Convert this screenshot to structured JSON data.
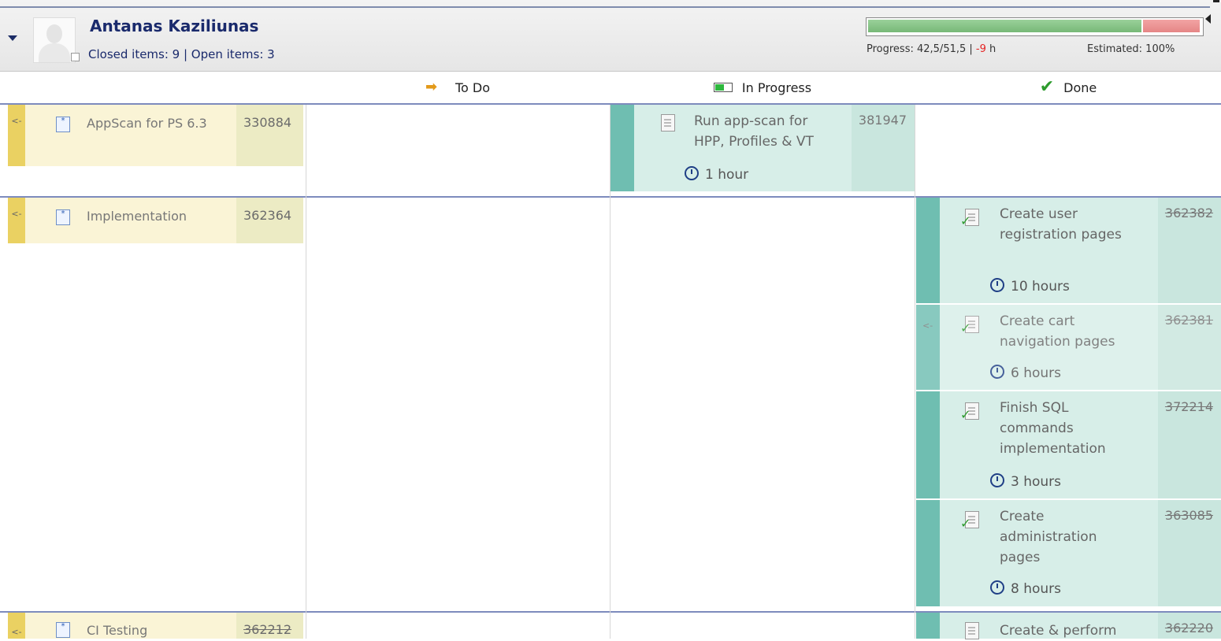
{
  "user": {
    "name": "Antanas Kaziliunas",
    "stats": "Closed items: 9 | Open items: 3"
  },
  "progress": {
    "label": "Progress: 42,5/51,5 |",
    "over": "-9",
    "unit": "h",
    "estimated": "Estimated: 100%",
    "done_fraction": 0.825,
    "over_fraction": 0.175,
    "colors": {
      "done": "#77b877",
      "over": "#e58585"
    }
  },
  "columns": {
    "todo": "To Do",
    "in_progress": "In Progress",
    "done": "Done"
  },
  "rows": [
    {
      "story": {
        "title": "AppScan for PS 6.3",
        "num": "330884"
      },
      "in_progress_task": {
        "title": "Run app-scan for HPP, Profiles & VT",
        "num": "381947",
        "time": "1 hour"
      }
    },
    {
      "story": {
        "title": "Implementation",
        "num": "362364"
      },
      "done_tasks": [
        {
          "title": "Create user registration pages",
          "num": "362382",
          "time": "10 hours"
        },
        {
          "title": "Create cart navigation pages",
          "num": "362381",
          "time": "6 hours"
        },
        {
          "title": "Finish SQL commands implementation",
          "num": "372214",
          "time": "3 hours"
        },
        {
          "title": "Create administration pages",
          "num": "363085",
          "time": "8 hours"
        }
      ]
    },
    {
      "story": {
        "title": "CI Testing",
        "num": "362212"
      },
      "done_tasks": [
        {
          "title": "Create & perform",
          "num": "362220"
        }
      ]
    }
  ]
}
